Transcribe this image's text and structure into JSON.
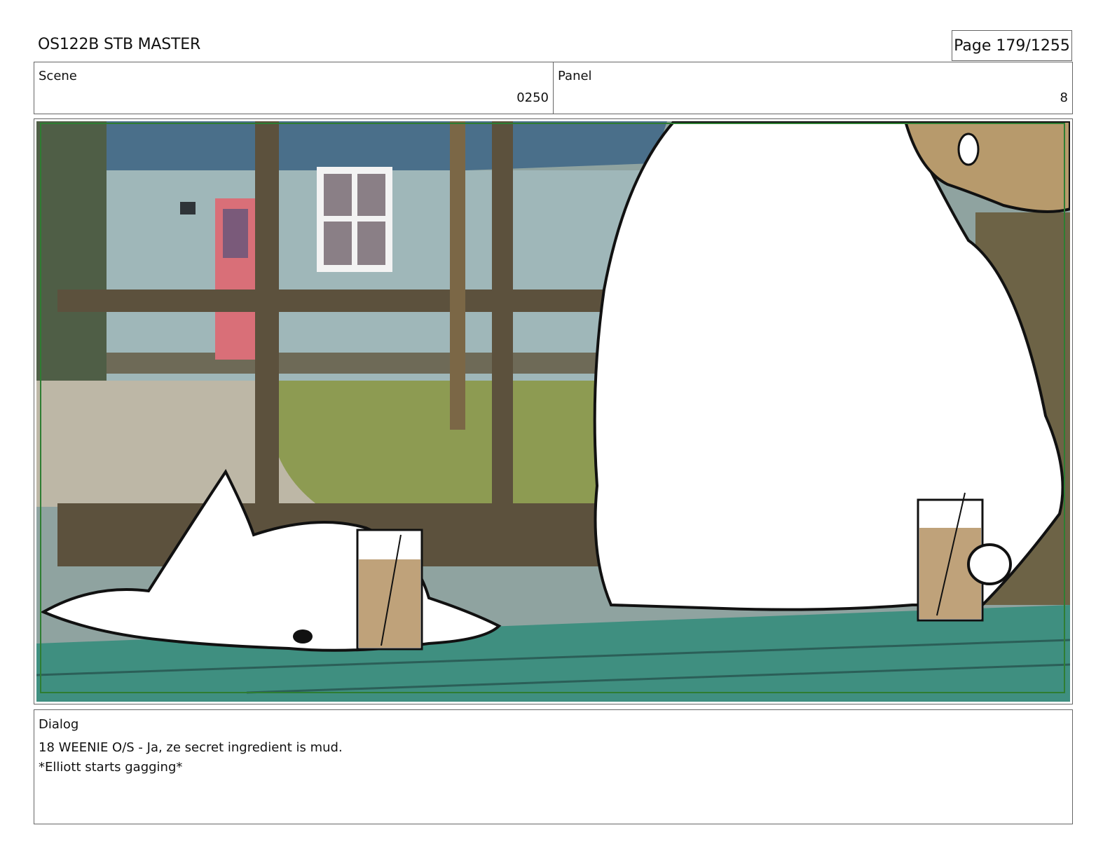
{
  "header": {
    "title": "OS122B STB MASTER",
    "page_label": "Page",
    "page_number": "179/1255"
  },
  "info": {
    "scene_label": "Scene",
    "scene_value": "0250",
    "panel_label": "Panel",
    "panel_value": "8"
  },
  "dialog": {
    "label": "Dialog",
    "lines": [
      "18 WEENIE O/S - Ja, ze secret ingredient is mud.",
      "*Elliott starts gagging*"
    ]
  },
  "colors": {
    "border": "#666666",
    "safe_frame": "#2e7d32",
    "table": "#3f8f80",
    "drink": "#bfa27a"
  }
}
